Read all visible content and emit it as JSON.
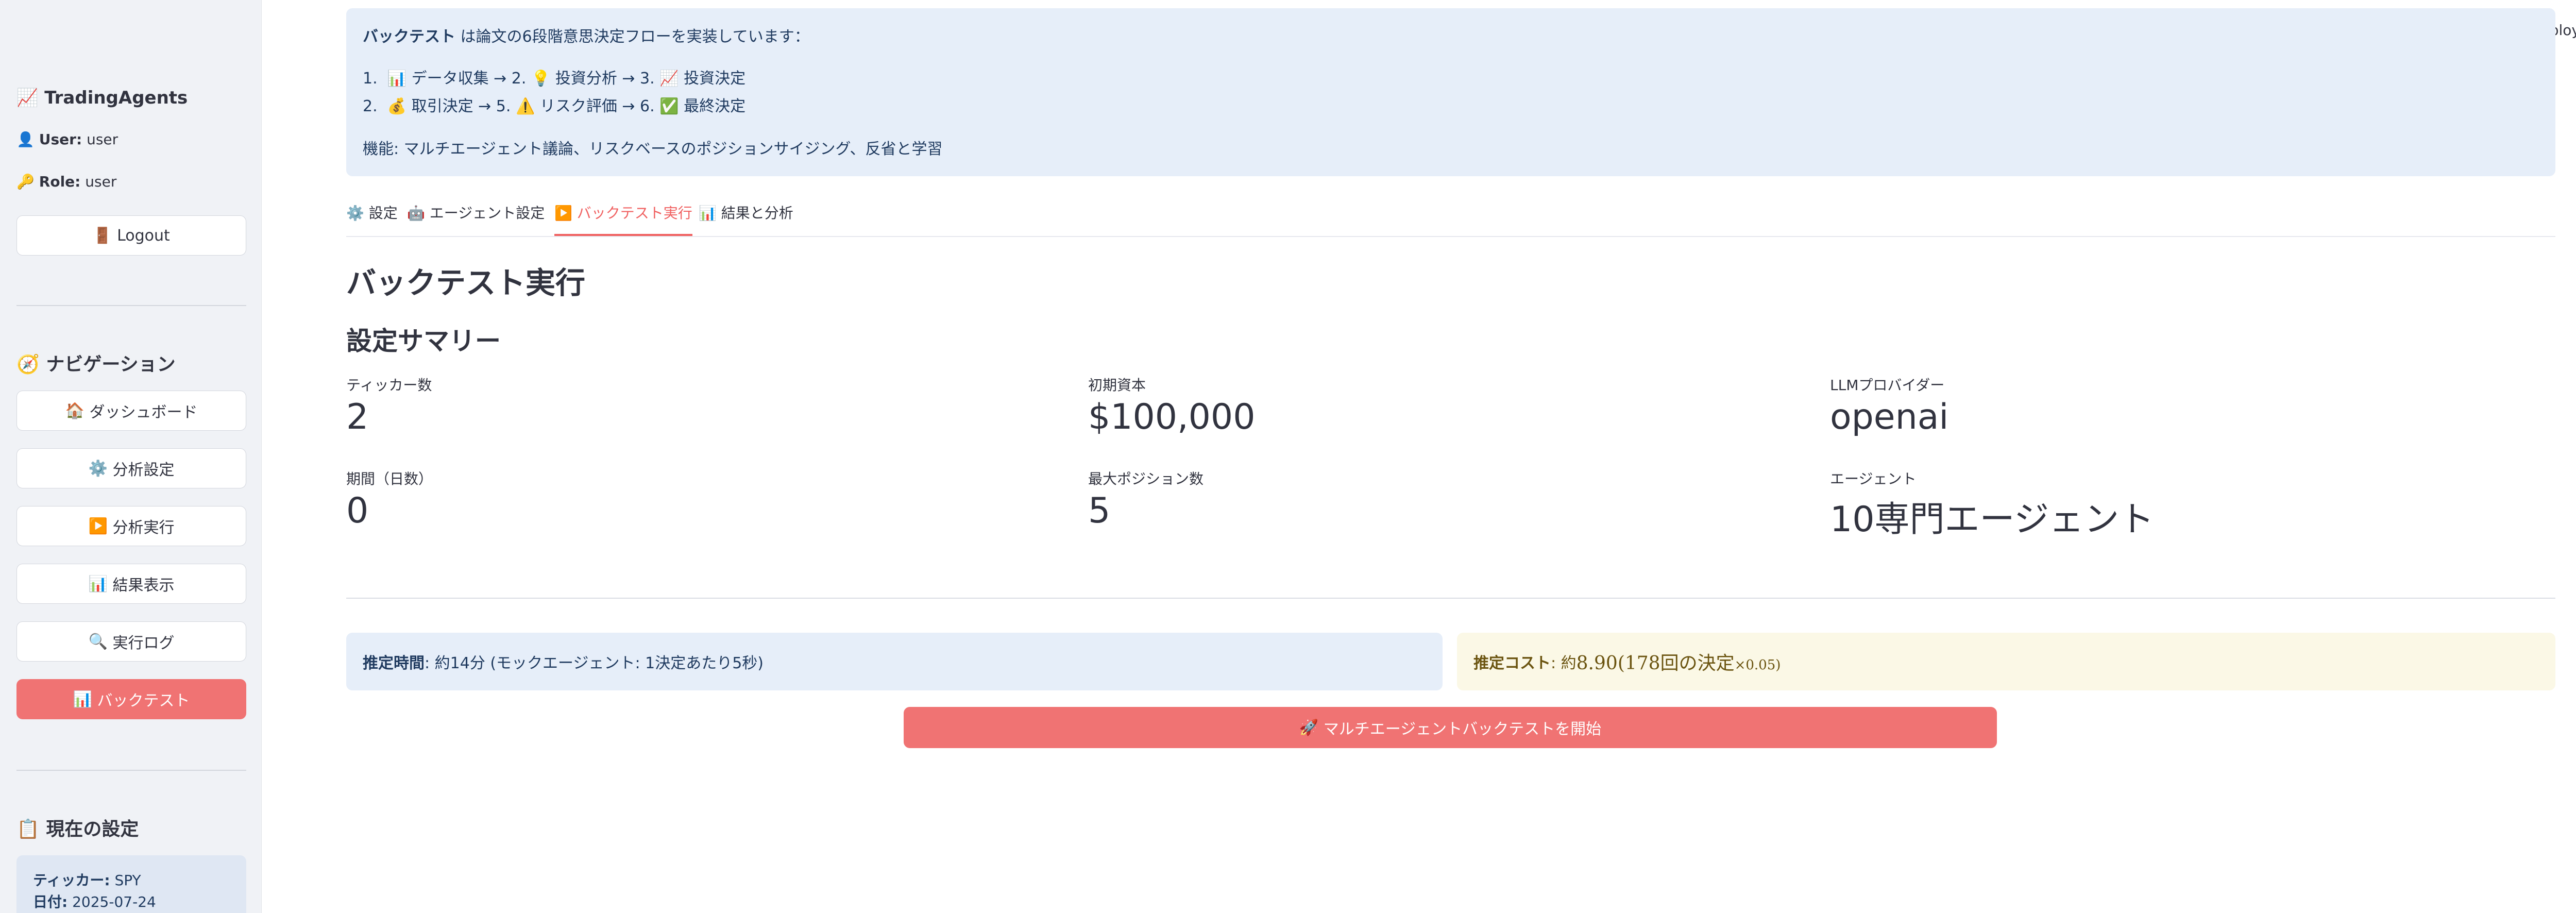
{
  "sidebar": {
    "app_icon": "📈",
    "app_title": "TradingAgents",
    "user_icon": "👤",
    "user_label": "User:",
    "user_value": "user",
    "role_icon": "🔑",
    "role_label": "Role:",
    "role_value": "user",
    "logout_icon": "🚪",
    "logout_label": "Logout",
    "nav_icon": "🧭",
    "nav_heading": "ナビゲーション",
    "nav_items": [
      {
        "icon": "🏠",
        "label": "ダッシュボード"
      },
      {
        "icon": "⚙️",
        "label": "分析設定"
      },
      {
        "icon": "▶️",
        "label": "分析実行"
      },
      {
        "icon": "📊",
        "label": "結果表示"
      },
      {
        "icon": "🔍",
        "label": "実行ログ"
      },
      {
        "icon": "📊",
        "label": "バックテスト",
        "active": true
      }
    ],
    "settings_icon": "📋",
    "settings_heading": "現在の設定",
    "ticker_label": "ティッカー:",
    "ticker_value": "SPY",
    "date_label": "日付:",
    "date_value": "2025-07-24"
  },
  "header": {
    "deploy_label": "Deploy",
    "menu_icon": "⋮"
  },
  "info": {
    "intro_bold": "バックテスト",
    "intro_rest": " は論文の6段階意思決定フローを実装しています：",
    "steps": [
      "📊 データ収集 → 2. 💡 投資分析 → 3. 📈 投資決定",
      "💰 取引決定 → 5. ⚠️ リスク評価 → 6. ✅ 最終決定"
    ],
    "features": "機能: マルチエージェント議論、リスクベースのポジションサイジング、反省と学習"
  },
  "tabs": [
    {
      "icon": "⚙️",
      "label": "設定"
    },
    {
      "icon": "🤖",
      "label": "エージェント設定"
    },
    {
      "icon": "▶️",
      "label": "バックテスト実行",
      "active": true
    },
    {
      "icon": "📊",
      "label": "結果と分析"
    }
  ],
  "main": {
    "title": "バックテスト実行",
    "summary_title": "設定サマリー",
    "metrics": [
      {
        "label": "ティッカー数",
        "value": "2"
      },
      {
        "label": "初期資本",
        "value": "$100,000"
      },
      {
        "label": "LLMプロバイダー",
        "value": "openai"
      },
      {
        "label": "期間（日数）",
        "value": "0"
      },
      {
        "label": "最大ポジション数",
        "value": "5"
      },
      {
        "label": "エージェント",
        "value": "10専門エージェント"
      }
    ],
    "est_time_label": "推定時間",
    "est_time_value": ": 約14分 (モックエージェント: 1決定あたり5秒)",
    "est_cost_label": "推定コスト",
    "est_cost_sep": ": 約",
    "est_cost_value": "8.90(178回の決定",
    "est_cost_tail": "×0.05)",
    "start_icon": "🚀",
    "start_label": "マルチエージェントバックテストを開始"
  },
  "colors": {
    "accent": "#f07373",
    "info_bg": "#e6eef9",
    "warn_bg": "#fbf8e6",
    "sidebar_bg": "#f0f2f6"
  }
}
